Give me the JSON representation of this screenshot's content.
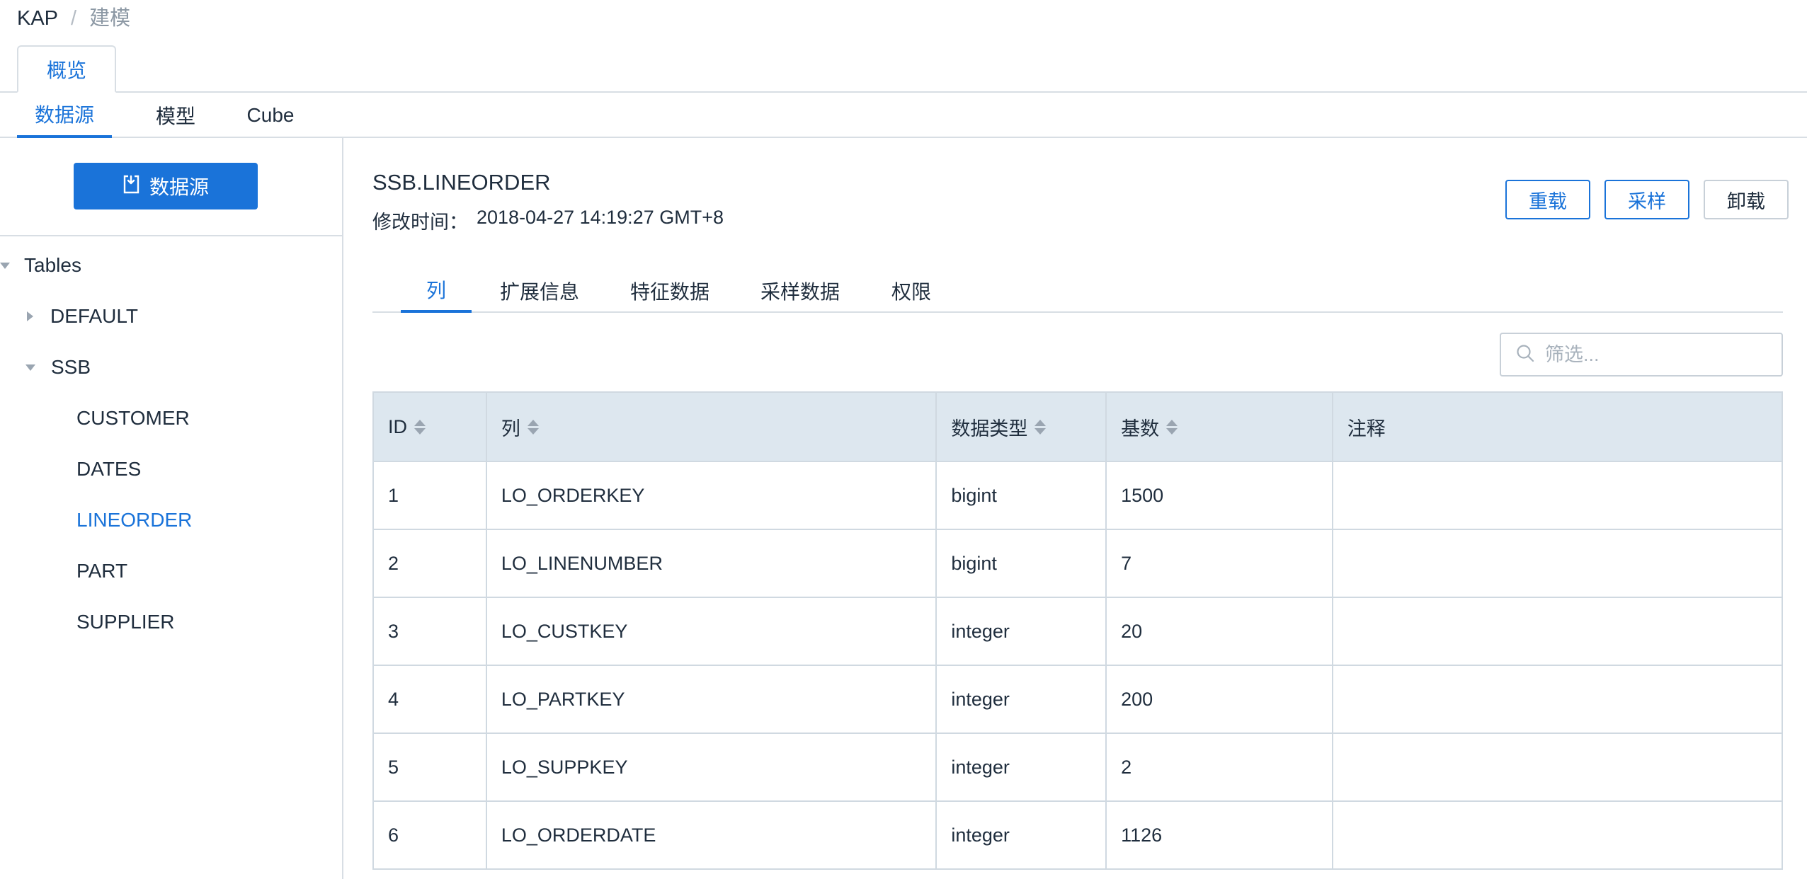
{
  "breadcrumb": {
    "root": "KAP",
    "separator": "/",
    "current": "建模"
  },
  "top_tabs": [
    {
      "label": "概览"
    }
  ],
  "sub_tabs": [
    {
      "label": "数据源"
    },
    {
      "label": "模型"
    },
    {
      "label": "Cube"
    }
  ],
  "sidebar": {
    "datasource_button": "数据源",
    "tree": {
      "root": "Tables",
      "databases": [
        {
          "name": "DEFAULT"
        },
        {
          "name": "SSB",
          "tables": [
            "CUSTOMER",
            "DATES",
            "LINEORDER",
            "PART",
            "SUPPLIER"
          ]
        }
      ]
    }
  },
  "main": {
    "table_name": "SSB.LINEORDER",
    "modified_label": "修改时间：",
    "modified_value": "2018-04-27 14:19:27 GMT+8",
    "actions": {
      "reload": "重载",
      "sample": "采样",
      "unload": "卸载"
    },
    "detail_tabs": [
      {
        "label": "列"
      },
      {
        "label": "扩展信息"
      },
      {
        "label": "特征数据"
      },
      {
        "label": "采样数据"
      },
      {
        "label": "权限"
      }
    ],
    "filter": {
      "placeholder": "筛选...",
      "value": ""
    },
    "columns_table": {
      "headers": [
        "ID",
        "列",
        "数据类型",
        "基数",
        "注释"
      ],
      "rows": [
        [
          "1",
          "LO_ORDERKEY",
          "bigint",
          "1500",
          ""
        ],
        [
          "2",
          "LO_LINENUMBER",
          "bigint",
          "7",
          ""
        ],
        [
          "3",
          "LO_CUSTKEY",
          "integer",
          "20",
          ""
        ],
        [
          "4",
          "LO_PARTKEY",
          "integer",
          "200",
          ""
        ],
        [
          "5",
          "LO_SUPPKEY",
          "integer",
          "2",
          ""
        ],
        [
          "6",
          "LO_ORDERDATE",
          "integer",
          "1126",
          ""
        ]
      ]
    }
  },
  "colors": {
    "accent": "#1a73d9",
    "header_bg": "#dde7ef",
    "border": "#d0d9e1"
  }
}
